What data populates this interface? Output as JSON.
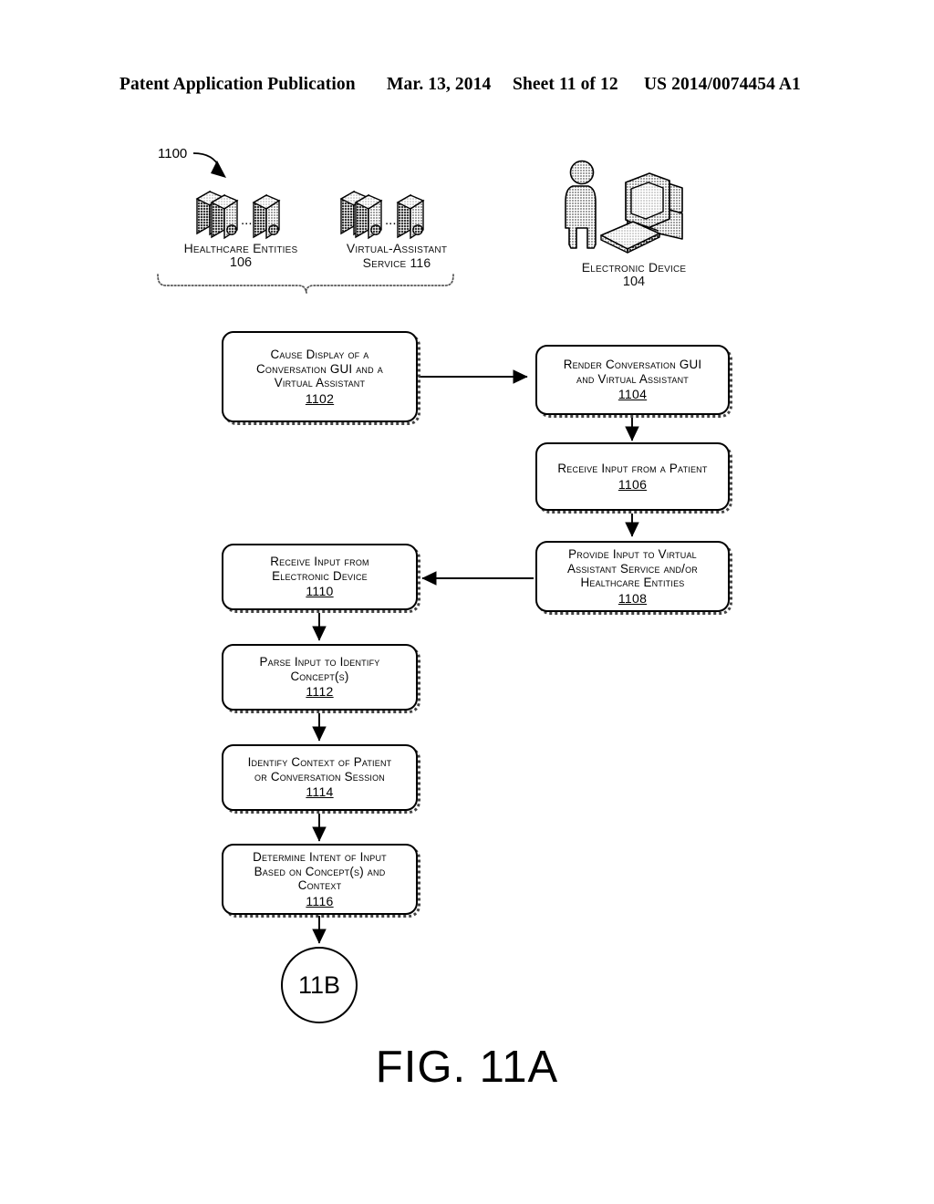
{
  "header": {
    "publication": "Patent Application Publication",
    "date": "Mar. 13, 2014",
    "sheet": "Sheet 11 of 12",
    "patent_number": "US 2014/0074454 A1"
  },
  "figure": {
    "reference_numeral": "1100",
    "caption": "FIG. 11A",
    "connector_label": "11B"
  },
  "entities": [
    {
      "id": "healthcare-entities",
      "label": "Healthcare Entities",
      "number": "106",
      "icon": "server-stack-icon",
      "ellipsis": "..."
    },
    {
      "id": "virtual-assistant-service",
      "label": "Virtual-Assistant",
      "label_line2": "Service 116",
      "number": "116",
      "icon": "server-stack-icon",
      "ellipsis": "..."
    },
    {
      "id": "electronic-device",
      "label": "Electronic Device",
      "number": "104",
      "icon": "person-and-computer-icon"
    }
  ],
  "steps": [
    {
      "id": "1102",
      "number": "1102",
      "lines": [
        "Cause Display of a",
        "Conversation GUI and a",
        "Virtual Assistant"
      ]
    },
    {
      "id": "1104",
      "number": "1104",
      "lines": [
        "Render Conversation GUI",
        "and Virtual Assistant"
      ]
    },
    {
      "id": "1106",
      "number": "1106",
      "lines": [
        "Receive Input from a Patient"
      ]
    },
    {
      "id": "1108",
      "number": "1108",
      "lines": [
        "Provide Input to Virtual",
        "Assistant Service and/or",
        "Healthcare Entities"
      ]
    },
    {
      "id": "1110",
      "number": "1110",
      "lines": [
        "Receive Input from",
        "Electronic Device"
      ]
    },
    {
      "id": "1112",
      "number": "1112",
      "lines": [
        "Parse Input to Identify",
        "Concept(s)"
      ]
    },
    {
      "id": "1114",
      "number": "1114",
      "lines": [
        "Identify Context of Patient",
        "or Conversation Session"
      ]
    },
    {
      "id": "1116",
      "number": "1116",
      "lines": [
        "Determine Intent of Input",
        "Based on Concept(s) and",
        "Context"
      ]
    }
  ],
  "colors": {
    "ink": "#000000",
    "paper": "#ffffff",
    "halftone": "#9a9a9a"
  }
}
